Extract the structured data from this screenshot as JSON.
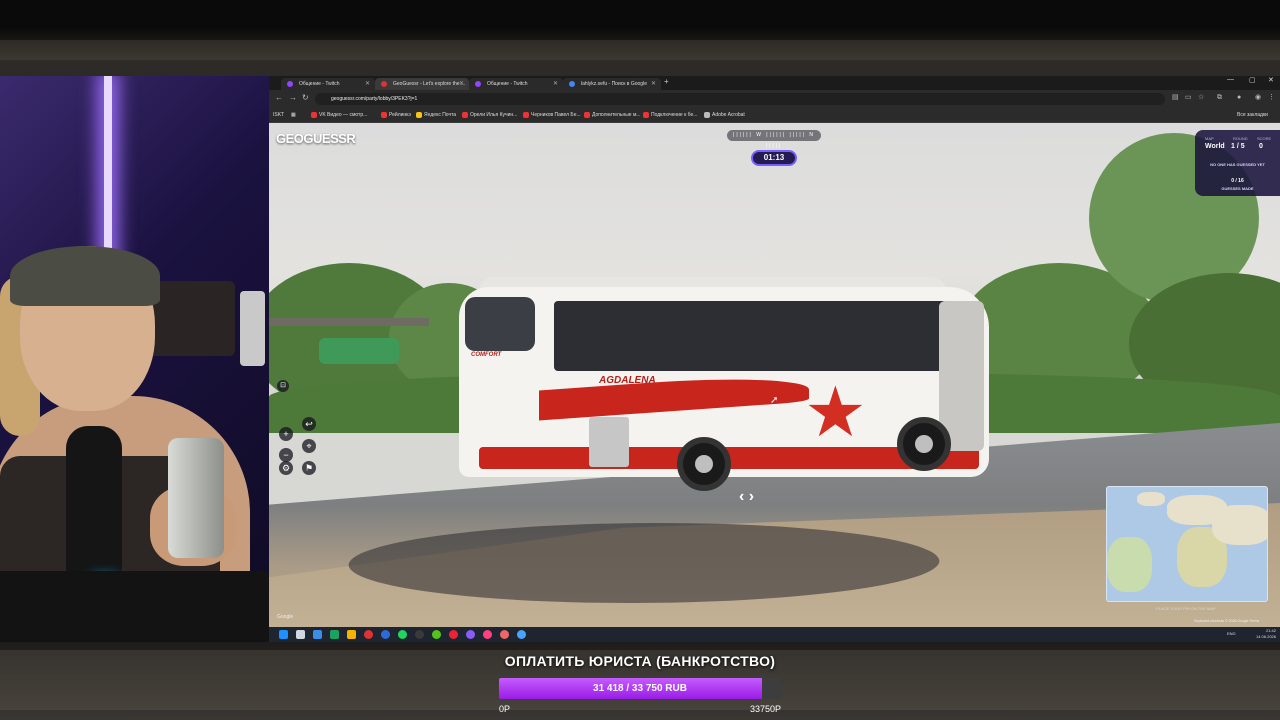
{
  "browser": {
    "tabs": [
      {
        "label": "Общение - Twitch",
        "favicon_color": "#9146ff",
        "active": false
      },
      {
        "label": "GeoGuessr - Let's explore the ...",
        "favicon_color": "#d33",
        "active": true
      },
      {
        "label": "Общение - Twitch",
        "favicon_color": "#9146ff",
        "active": false
      },
      {
        "label": "lahlykz.sefu - Поиск в Google",
        "favicon_color": "#4285f4",
        "active": false
      }
    ],
    "new_tab": "+",
    "url": "geoguessr.com/party/lobby/3PEK3?j=1",
    "bookmarks": [
      {
        "label": "VK Видео — смотр...",
        "color": "#e33"
      },
      {
        "label": "Рейлинкэ",
        "color": "#e33"
      },
      {
        "label": "Яндекс Почта",
        "color": "#f5c518"
      },
      {
        "label": "Орели Илья Кучин...",
        "color": "#e33"
      },
      {
        "label": "Черников Павел Бе...",
        "color": "#e33"
      },
      {
        "label": "Дополнительные м...",
        "color": "#e33"
      },
      {
        "label": "Подключение к бе...",
        "color": "#e33"
      },
      {
        "label": "Adobe Acrobat",
        "color": "#bbb"
      }
    ],
    "bookmarks_all": "Все закладки",
    "bookmarks_left": "ISKT"
  },
  "game": {
    "logo": "GEOGUESSR",
    "compass": "|||||| W |||||| ||||| N |||||",
    "timer": "01:13",
    "status": {
      "map_label": "MAP",
      "map_value": "World",
      "round_label": "ROUND",
      "round_value": "1 / 5",
      "score_label": "SCORE",
      "score_value": "0",
      "no_guess": "NO ONE HAS GUESSED YET",
      "guesses_count": "0 / 16",
      "guesses_label": "GUESSES MADE"
    },
    "controls": {
      "zoom_in": "+",
      "zoom_out": "−",
      "undo": "↩",
      "pin": "⌖",
      "settings": "⚙",
      "flag": "⚑"
    },
    "minimap_hint": "PLACE YOUR PIN ON THE MAP",
    "attribution": "Keyboard shortcuts   © 2026 Google   Terms",
    "google": "Google",
    "move_arrows": "‹   ›",
    "bus_text": {
      "company": "AGDALENA",
      "rear": "COMFORT"
    }
  },
  "taskbar": {
    "lang": "ENG",
    "time": "21:42",
    "date": "14.06.2026",
    "icon_colors": [
      "#1e90ff",
      "#cfd7e3",
      "#3a8ee6",
      "#1aa260",
      "#f4b400",
      "#d33",
      "#2e6bd6",
      "#1ed760",
      "#3a3a3a",
      "#52c41a",
      "#e23",
      "#8a5cf6",
      "#ff3f7f",
      "#e66",
      "#4aa3ff"
    ]
  },
  "donation_goal": {
    "title": "ОПЛАТИТЬ ЮРИСТА (БАНКРОТСТВО)",
    "amount_text": "31 418 / 33 750 RUB",
    "current": 31418,
    "target": 33750,
    "min_label": "0Р",
    "max_label": "33750Р",
    "fill_color": "#a52cf0"
  }
}
